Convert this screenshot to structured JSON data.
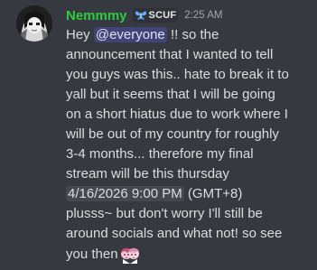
{
  "message": {
    "author": "Nemmmy",
    "author_color": "#2ecc40",
    "tag": {
      "icon": "butterfly-icon",
      "text": "SCUF"
    },
    "timestamp": "2:25 AM",
    "content": {
      "line1_pre": "Hey ",
      "mention": "@everyone",
      "line1_post": " !! so the",
      "line2": "announcement that I wanted to tell",
      "line3": "you guys was this.. hate to break it to",
      "line4": "yall but it seems that I will be going",
      "line5": "on a short hiatus due to work where I",
      "line6": "will be out of my country for roughly",
      "line7": "3-4 months... therefore my final",
      "line8": "stream will be this thursday",
      "timestamp_pill": "4/16/2026 9:00 PM",
      "line9_post": " (GMT+8)",
      "line10": "plusss~ but don't worry I'll still be",
      "line11": "around socials and what not! so see",
      "line12": "you then",
      "emoji": "anime-girls-emoji"
    }
  }
}
